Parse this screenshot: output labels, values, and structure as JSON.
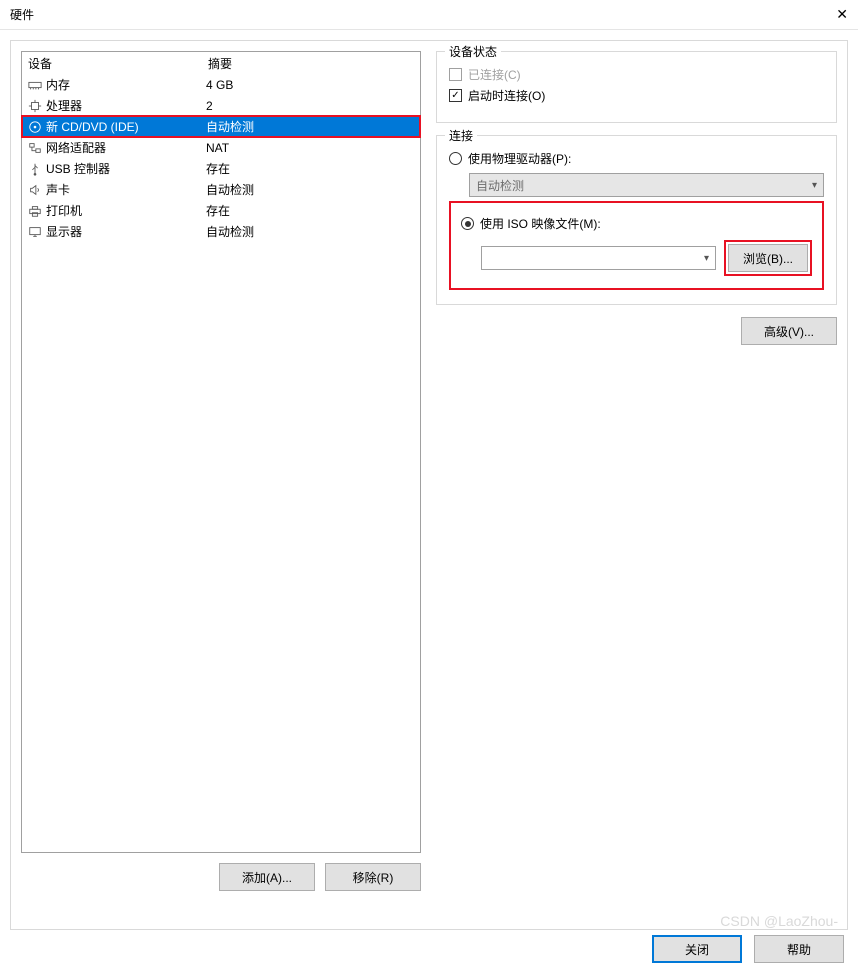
{
  "window": {
    "title": "硬件",
    "close_glyph": "✕"
  },
  "device_table": {
    "header_device": "设备",
    "header_summary": "摘要",
    "rows": [
      {
        "icon": "memory-icon",
        "label": "内存",
        "summary": "4 GB",
        "selected": false
      },
      {
        "icon": "cpu-icon",
        "label": "处理器",
        "summary": "2",
        "selected": false
      },
      {
        "icon": "cd-icon",
        "label": "新 CD/DVD (IDE)",
        "summary": "自动检测",
        "selected": true,
        "highlighted": true
      },
      {
        "icon": "network-icon",
        "label": "网络适配器",
        "summary": "NAT",
        "selected": false
      },
      {
        "icon": "usb-icon",
        "label": "USB 控制器",
        "summary": "存在",
        "selected": false
      },
      {
        "icon": "sound-icon",
        "label": "声卡",
        "summary": "自动检测",
        "selected": false
      },
      {
        "icon": "printer-icon",
        "label": "打印机",
        "summary": "存在",
        "selected": false
      },
      {
        "icon": "display-icon",
        "label": "显示器",
        "summary": "自动检测",
        "selected": false
      }
    ]
  },
  "buttons": {
    "add": "添加(A)...",
    "remove": "移除(R)",
    "close": "关闭",
    "help": "帮助",
    "browse": "浏览(B)...",
    "advanced": "高级(V)..."
  },
  "device_status": {
    "legend": "设备状态",
    "connected_label": "已连接(C)",
    "connected_checked": false,
    "connected_enabled": false,
    "connect_on_power_label": "启动时连接(O)",
    "connect_on_power_checked": true
  },
  "connection": {
    "legend": "连接",
    "physical_label": "使用物理驱动器(P):",
    "physical_selected": false,
    "physical_combo_value": "自动检测",
    "iso_label": "使用 ISO 映像文件(M):",
    "iso_selected": true,
    "iso_path": ""
  },
  "watermark": "CSDN @LaoZhou-"
}
